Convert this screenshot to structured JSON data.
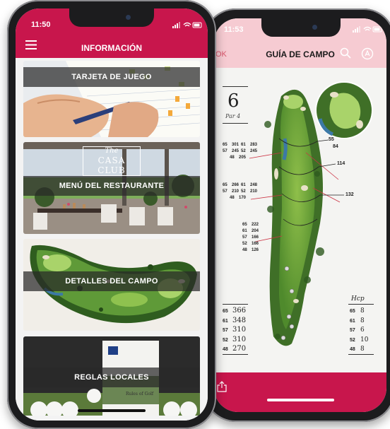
{
  "left_phone": {
    "status": {
      "time": "11:50"
    },
    "header": {
      "title": "INFORMACIÓN",
      "menu_icon": "hamburger-menu-icon"
    },
    "cards": [
      {
        "label": "TARJETA DE JUEGO"
      },
      {
        "label": "MENÚ DEL RESTAURANTE",
        "sign_line1": "The",
        "sign_line2": "CASA CLUB"
      },
      {
        "label": "DETALLES DEL CAMPO"
      },
      {
        "label": "REGLAS LOCALES",
        "book_title": "Rules of Golf"
      }
    ]
  },
  "right_phone": {
    "status": {
      "time": "11:53"
    },
    "navbar": {
      "back_label": "OK",
      "title": "GUÍA DE CAMPO",
      "search_icon": "search-icon",
      "user_icon": "user-circle-icon"
    },
    "hole": {
      "number": "6",
      "par_label": "Par 4"
    },
    "distance_groups": [
      {
        "rows": [
          [
            "65",
            "301",
            "61",
            "283"
          ],
          [
            "57",
            "245",
            "52",
            "245"
          ],
          [
            "48",
            "205"
          ]
        ]
      },
      {
        "rows": [
          [
            "65",
            "266",
            "61",
            "248"
          ],
          [
            "57",
            "210",
            "52",
            "210"
          ],
          [
            "48",
            "170"
          ]
        ]
      },
      {
        "rows": [
          [
            "65",
            "222"
          ],
          [
            "61",
            "204"
          ],
          [
            "57",
            "166"
          ],
          [
            "52",
            "166"
          ],
          [
            "48",
            "126"
          ]
        ]
      }
    ],
    "markers": [
      "55",
      "84",
      "114",
      "132"
    ],
    "tees": [
      {
        "tee": "65",
        "dist": "366"
      },
      {
        "tee": "61",
        "dist": "348"
      },
      {
        "tee": "57",
        "dist": "310"
      },
      {
        "tee": "52",
        "dist": "310"
      },
      {
        "tee": "48",
        "dist": "270"
      }
    ],
    "hcp_title": "Hcp",
    "hcp": [
      {
        "tee": "65",
        "value": "8"
      },
      {
        "tee": "61",
        "value": "8"
      },
      {
        "tee": "57",
        "value": "6"
      },
      {
        "tee": "52",
        "value": "10"
      },
      {
        "tee": "48",
        "value": "8"
      }
    ],
    "bottom_bar": {
      "share_icon": "share-icon"
    }
  },
  "colors": {
    "brand": "#c8164c",
    "light_pink": "#f6cbd2",
    "card_bar": "#2a2a2a"
  }
}
